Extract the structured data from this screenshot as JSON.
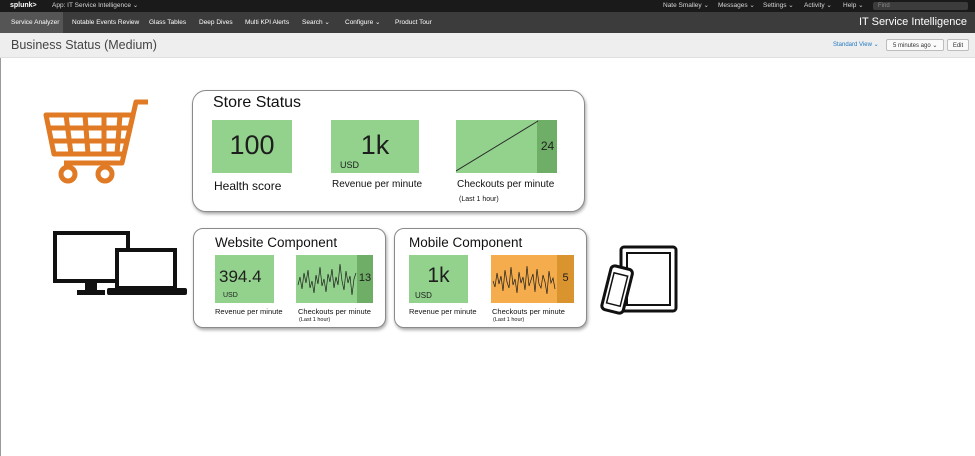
{
  "topbar": {
    "logo": "splunk>",
    "app": "App: IT Service Intelligence ⌄",
    "menus": [
      "Nate Smalley ⌄",
      "Messages ⌄",
      "Settings ⌄",
      "Activity ⌄",
      "Help ⌄"
    ],
    "find_placeholder": "Find"
  },
  "appbar": {
    "nav": [
      "Service Analyzer",
      "Notable Events Review",
      "Glass Tables",
      "Deep Dives",
      "Multi KPI Alerts",
      "Search ⌄",
      "Configure ⌄",
      "Product Tour"
    ],
    "active_index": 0,
    "app_title": "IT Service Intelligence"
  },
  "titlebar": {
    "page_title": "Business Status (Medium)",
    "view_label": "Standard View ⌄",
    "time_label": "5 minutes ago ⌄",
    "edit_label": "Edit"
  },
  "store": {
    "title": "Store Status",
    "health": {
      "value": "100",
      "label": "Health score"
    },
    "revenue": {
      "value": "1k",
      "unit": "USD",
      "label": "Revenue per minute"
    },
    "checkouts": {
      "value": "24",
      "label": "Checkouts per minute",
      "sublabel": "(Last 1 hour)"
    }
  },
  "website": {
    "title": "Website Component",
    "revenue": {
      "value": "394.4",
      "unit": "USD",
      "label": "Revenue per minute"
    },
    "checkouts": {
      "value": "13",
      "label": "Checkouts per minute",
      "sublabel": "(Last 1 hour)"
    }
  },
  "mobile": {
    "title": "Mobile Component",
    "revenue": {
      "value": "1k",
      "unit": "USD",
      "label": "Revenue per minute"
    },
    "checkouts": {
      "value": "5",
      "label": "Checkouts per minute",
      "sublabel": "(Last 1 hour)"
    }
  },
  "icons": [
    "shopping-cart-icon",
    "desktop-laptop-icon",
    "phone-tablet-icon",
    "chevron-down-icon"
  ],
  "colors": {
    "ok": "#92d28c",
    "warning": "#f4ac4c",
    "topbar": "#1a1a1a",
    "appbar": "#3c3c3c",
    "link": "#1f78c1",
    "cart": "#e07a24"
  }
}
